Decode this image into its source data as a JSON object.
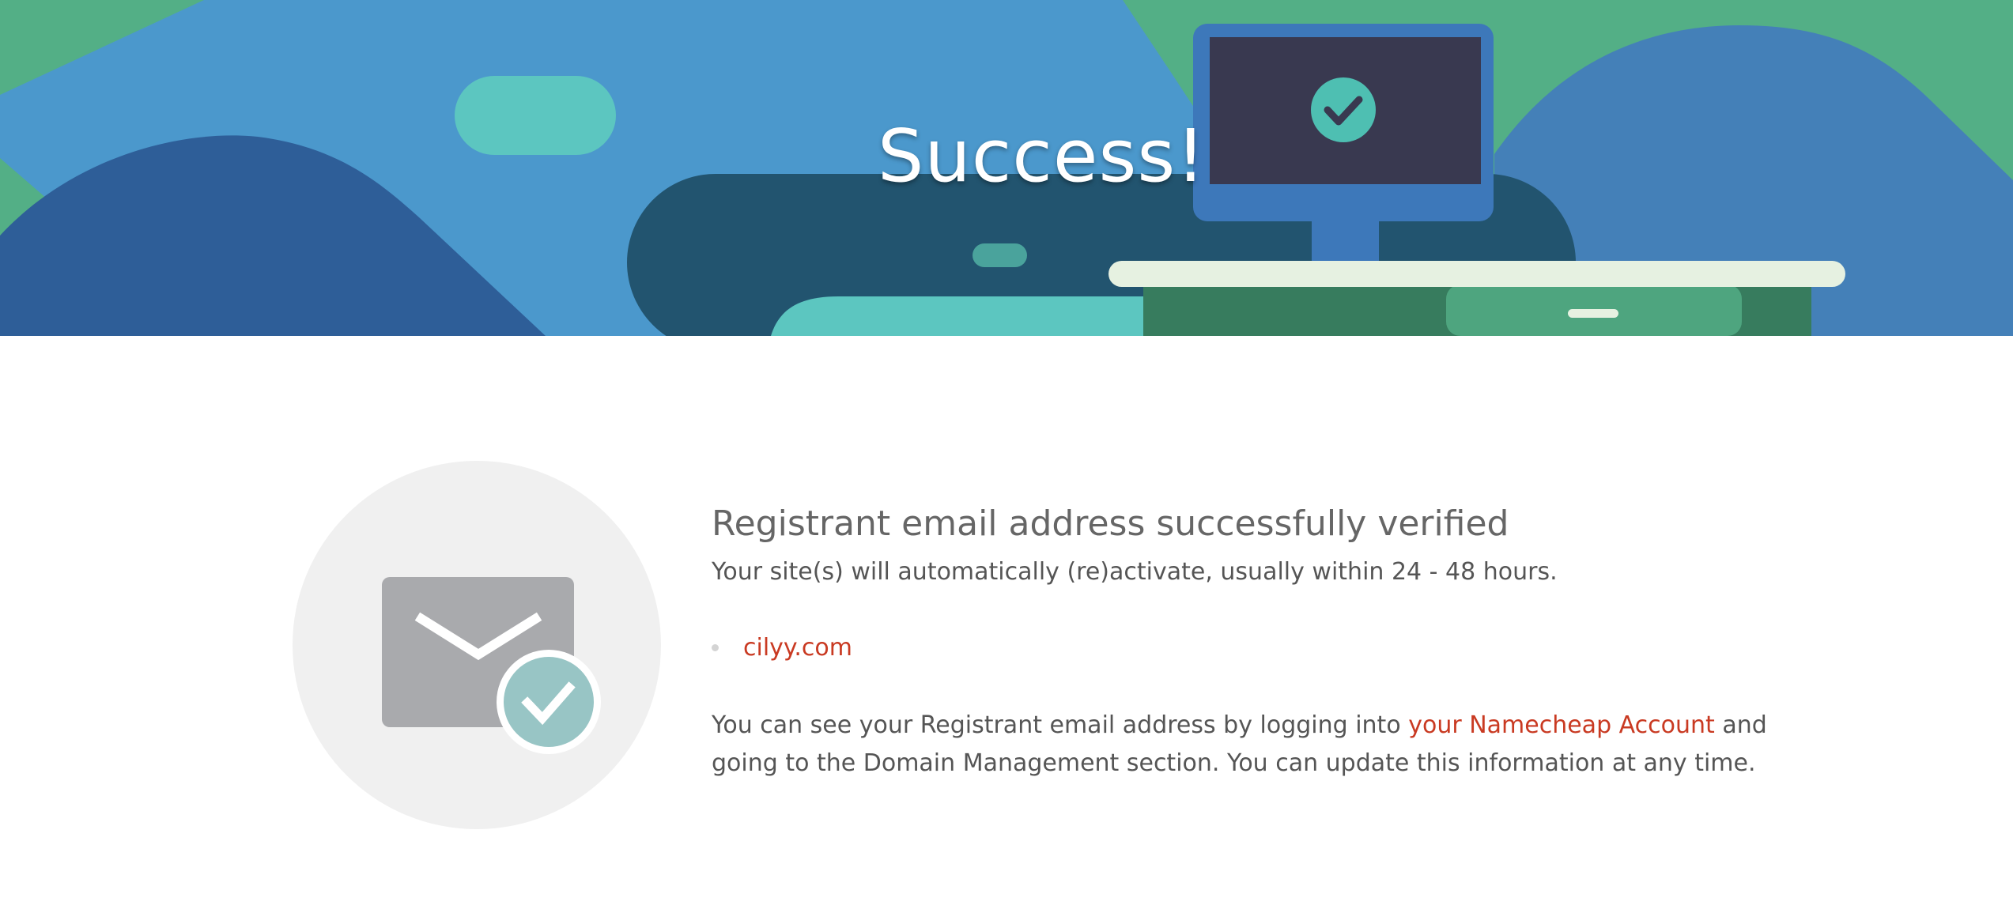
{
  "hero": {
    "title": "Success!"
  },
  "icons": {
    "envelope": "envelope-icon",
    "check_badge": "check-badge-icon",
    "monitor_check": "check-icon"
  },
  "message": {
    "heading": "Registrant email address successfully verified",
    "subtext": "Your site(s) will automatically (re)activate, usually within 24 - 48 hours.",
    "domains": [
      "cilyy.com"
    ],
    "info_before": "You can see your Registrant email address by logging into ",
    "info_link": "your Namecheap Account",
    "info_after": " and going to the Domain Management section. You can update this information at any time."
  },
  "colors": {
    "link": "#c93a22",
    "heading": "#666666",
    "body_text": "#555555",
    "hero_green": "#53af86",
    "hero_blue": "#4b98cc",
    "check_badge": "#98c5c5",
    "envelope": "#a9aaad"
  }
}
